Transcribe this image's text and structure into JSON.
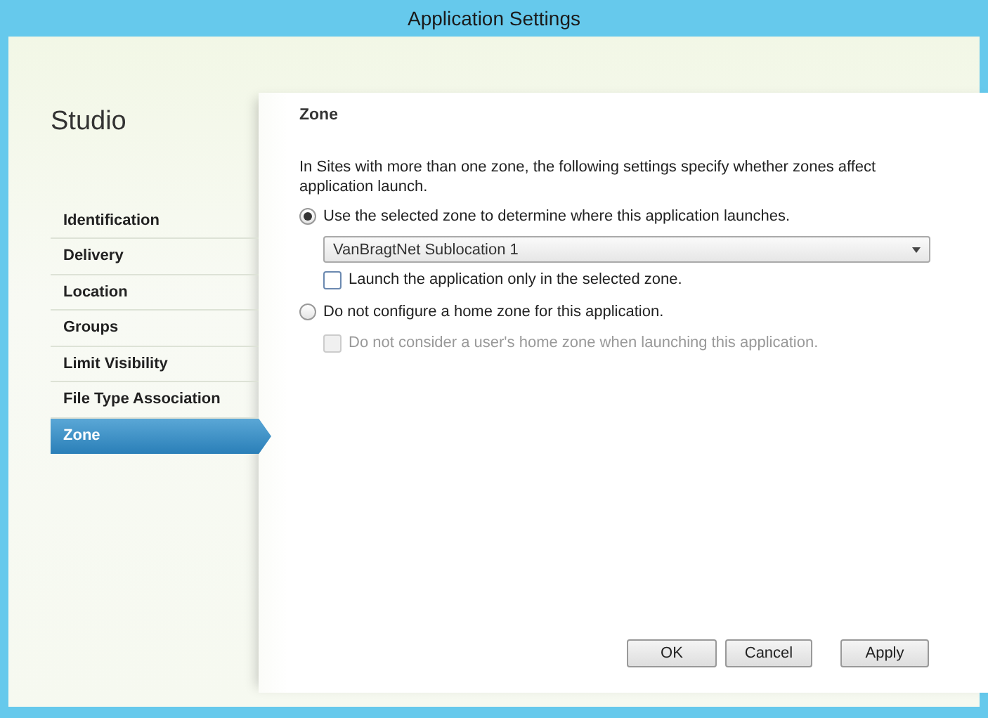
{
  "window": {
    "title": "Application Settings"
  },
  "sidebar": {
    "heading": "Studio",
    "items": [
      {
        "label": "Identification",
        "selected": false
      },
      {
        "label": "Delivery",
        "selected": false
      },
      {
        "label": "Location",
        "selected": false
      },
      {
        "label": "Groups",
        "selected": false
      },
      {
        "label": "Limit Visibility",
        "selected": false
      },
      {
        "label": "File Type Association",
        "selected": false
      },
      {
        "label": "Zone",
        "selected": true
      }
    ]
  },
  "page": {
    "heading": "Zone",
    "description": "In Sites with more than one zone, the following settings specify whether zones affect application launch.",
    "options": [
      {
        "label": "Use the selected zone to determine where this application launches.",
        "selected": true,
        "dropdown": {
          "value": "VanBragtNet Sublocation 1"
        },
        "checkbox": {
          "label": "Launch the application only in the selected zone.",
          "checked": false,
          "disabled": false
        }
      },
      {
        "label": "Do not configure a home zone for this application.",
        "selected": false,
        "checkbox": {
          "label": "Do not consider a user's home zone when launching this application.",
          "checked": false,
          "disabled": true
        }
      }
    ]
  },
  "buttons": [
    "OK",
    "Cancel",
    "Apply"
  ]
}
